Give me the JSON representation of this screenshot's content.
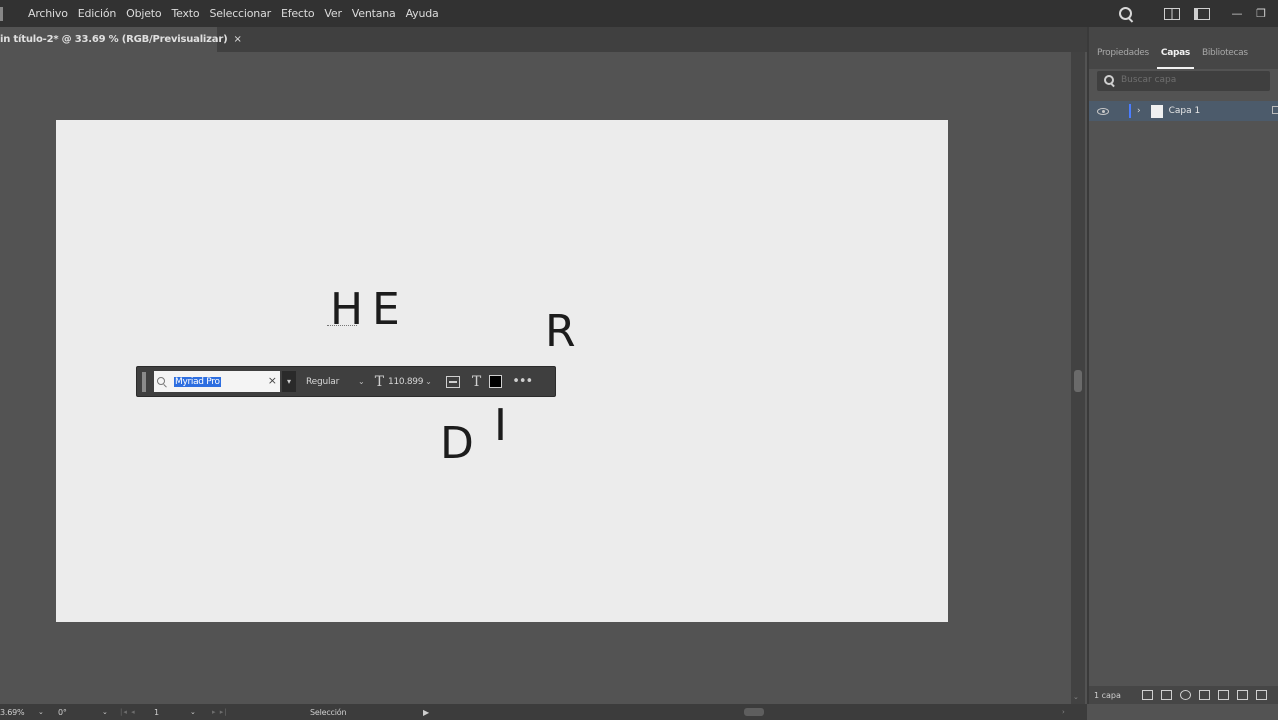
{
  "menubar": {
    "items": [
      "Archivo",
      "Edición",
      "Objeto",
      "Texto",
      "Seleccionar",
      "Efecto",
      "Ver",
      "Ventana",
      "Ayuda"
    ],
    "window_minimize": "—",
    "window_restore": "❐"
  },
  "document_tab": {
    "label": "in título-2* @ 33.69 % (RGB/Previsualizar)",
    "close": "×"
  },
  "artboard": {
    "background": "#ececec",
    "letters": {
      "h": "H",
      "e": "E",
      "r": "R",
      "d": "D",
      "i": "I"
    }
  },
  "task_bar": {
    "font_name": "Myriad Pro",
    "font_clear": "×",
    "font_dropdown": "▾",
    "style": "Regular",
    "style_chevron": "⌄",
    "size_icon": "T",
    "size_value": "110.899",
    "size_chevron": "⌄",
    "type_icon": "T",
    "more": "•••",
    "swatch_color": "#000000"
  },
  "right_panel": {
    "tabs": [
      "Propiedades",
      "Capas",
      "Bibliotecas"
    ],
    "active_tab": "Capas",
    "search_placeholder": "Buscar capa",
    "layer": {
      "expand": "›",
      "name": "Capa 1"
    },
    "layer_count": "1 capa"
  },
  "statusbar": {
    "zoom": "3.69%",
    "rotation": "0°",
    "nav_prev": "|◂ ◂",
    "page": "1",
    "nav_next": "▸ ▸|",
    "tool": "Selección",
    "play": "▶",
    "chevron": "⌄",
    "hscroll_right": "›"
  }
}
